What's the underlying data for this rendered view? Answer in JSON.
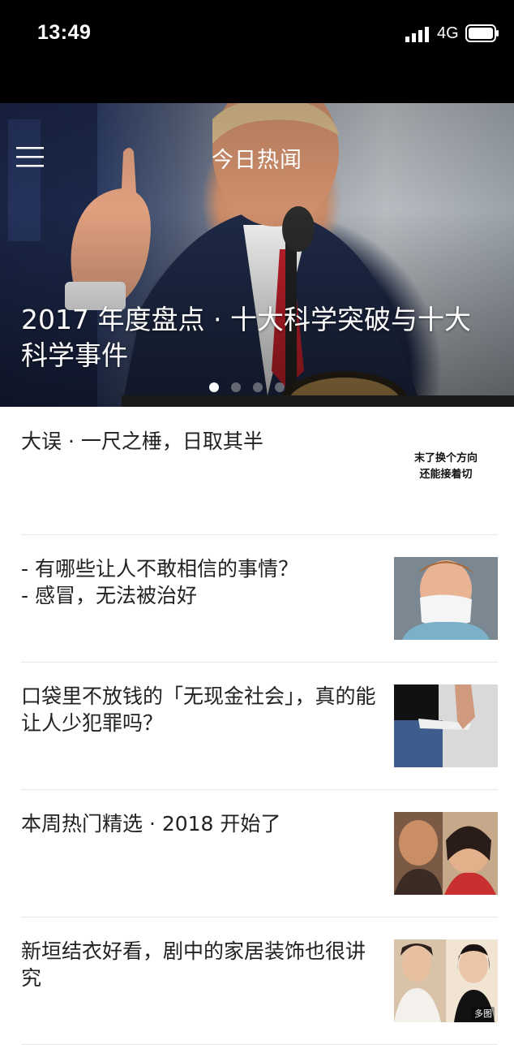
{
  "status_bar": {
    "time": "13:49",
    "network": "4G",
    "icons": [
      "signal-icon",
      "battery-icon"
    ]
  },
  "header": {
    "title": "今日热闻",
    "menu_icon": "menu-icon"
  },
  "hero": {
    "headline": "2017 年度盘点 · 十大科学突破与十大科学事件",
    "carousel": {
      "total": 4,
      "active": 1
    }
  },
  "feed": {
    "items": [
      {
        "title": "大误 · 一尺之棰，日取其半",
        "thumb_text_line1": "末了换个方向",
        "thumb_text_line2": "还能接着切"
      },
      {
        "title": "- 有哪些让人不敢相信的事情？\n- 感冒，无法被治好"
      },
      {
        "title": "口袋里不放钱的「无现金社会」，真的能让人少犯罪吗？"
      },
      {
        "title": "本周热门精选 · 2018 开始了"
      },
      {
        "title": "新垣结衣好看，剧中的家居装饰也很讲究",
        "badge": "多图"
      }
    ]
  }
}
